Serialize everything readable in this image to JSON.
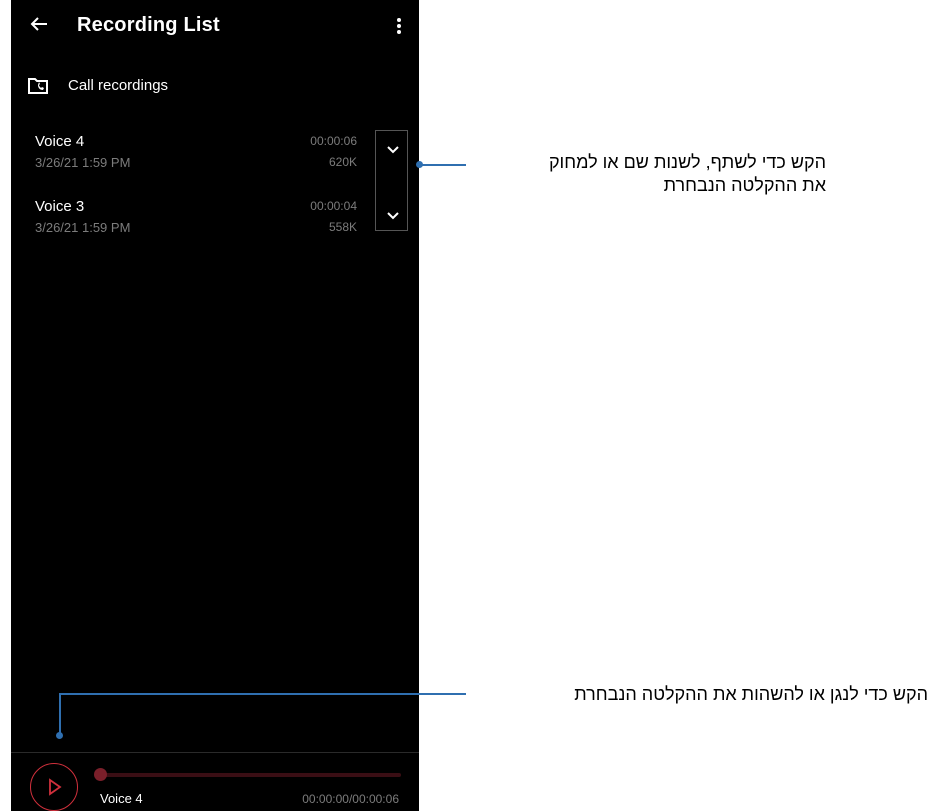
{
  "app": {
    "title": "Recording List"
  },
  "header": {
    "back_icon": "arrow-left-icon",
    "menu_icon": "more-vertical-icon"
  },
  "folder": {
    "label": "Call recordings",
    "icon": "folder-phone-icon"
  },
  "recordings": [
    {
      "name": "Voice 4",
      "date": "3/26/21 1:59 PM",
      "duration": "00:00:06",
      "size": "620K"
    },
    {
      "name": "Voice 3",
      "date": "3/26/21 1:59 PM",
      "duration": "00:00:04",
      "size": "558K"
    }
  ],
  "player": {
    "title": "Voice 4",
    "time": "00:00:00/00:00:06",
    "progress": 0
  },
  "callouts": {
    "options_line1": "הקש כדי לשתף, לשנות שם או למחוק",
    "options_line2": "את ההקלטה הנבחרת",
    "play": "הקש כדי לנגן או להשהות את ההקלטה הנבחרת"
  },
  "colors": {
    "accent": "#d0303c",
    "callout": "#2f6fb0",
    "background": "#000000"
  }
}
